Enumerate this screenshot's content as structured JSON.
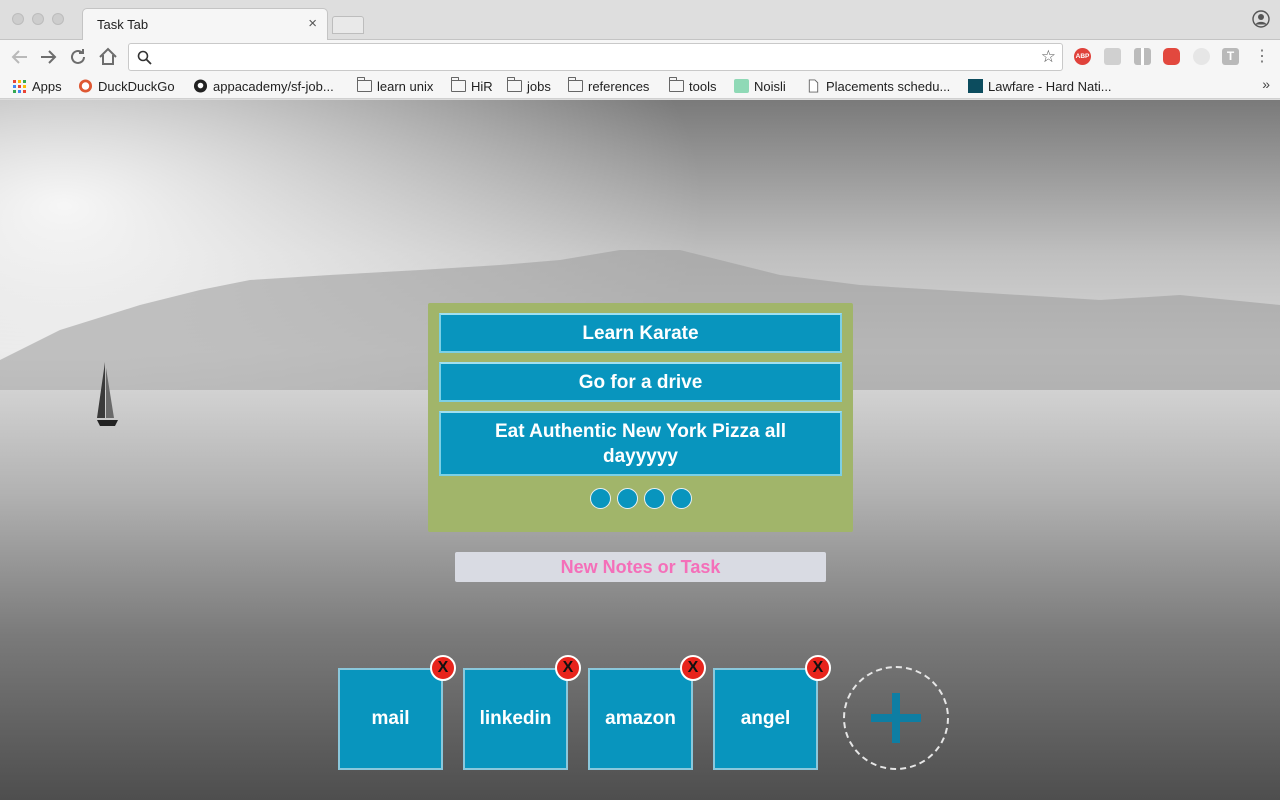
{
  "browser": {
    "tab_title": "Task Tab",
    "tab_close": "×",
    "omnibox_value": "",
    "bookmarks": [
      {
        "label": "Apps",
        "icon": "apps-grid-icon"
      },
      {
        "label": "DuckDuckGo",
        "icon": "duckduckgo-icon"
      },
      {
        "label": "appacademy/sf-job...",
        "icon": "github-icon"
      },
      {
        "label": "learn unix",
        "icon": "folder-icon"
      },
      {
        "label": "HiR",
        "icon": "folder-icon"
      },
      {
        "label": "jobs",
        "icon": "folder-icon"
      },
      {
        "label": "references",
        "icon": "folder-icon"
      },
      {
        "label": "tools",
        "icon": "folder-icon"
      },
      {
        "label": "Noisli",
        "icon": "noisli-icon"
      },
      {
        "label": "Placements schedu...",
        "icon": "page-icon"
      },
      {
        "label": "Lawfare - Hard Nati...",
        "icon": "lawfare-icon"
      }
    ],
    "more_bookmarks": "»",
    "extensions": {
      "abp_label": "ABP",
      "t_label": "T"
    }
  },
  "tasks": [
    {
      "label": "Learn Karate"
    },
    {
      "label": "Go for a drive"
    },
    {
      "label": "Eat Authentic New York Pizza all dayyyyy"
    }
  ],
  "pagination_count": 4,
  "new_task": {
    "placeholder": "New Notes or Task",
    "value": ""
  },
  "links": [
    {
      "label": "mail"
    },
    {
      "label": "linkedin"
    },
    {
      "label": "amazon"
    },
    {
      "label": "angel"
    }
  ],
  "remove_label": "X",
  "colors": {
    "task_bg": "#0895be",
    "panel_bg": "#a1b56a",
    "placeholder": "#f46fb9",
    "remove": "#e8241c"
  }
}
